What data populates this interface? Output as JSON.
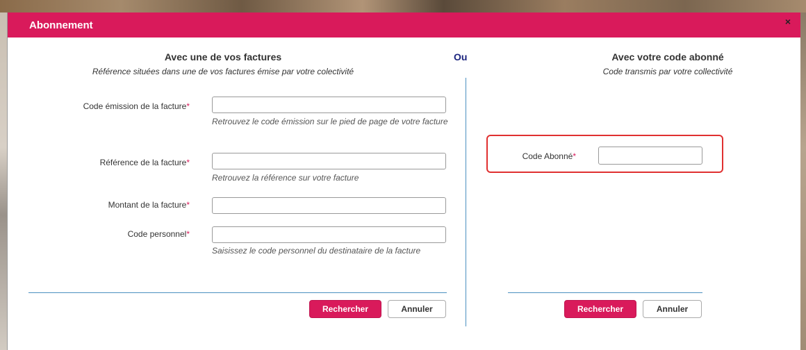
{
  "modal": {
    "title": "Abonnement",
    "close_label": "×"
  },
  "left": {
    "title": "Avec une de vos factures",
    "subtitle": "Référence situées dans une de vos factures émise par votre colectivité",
    "fields": [
      {
        "label": "Code émission de la facture",
        "required": "*",
        "value": "",
        "help": "Retrouvez le code émission sur le pied de page de votre facture"
      },
      {
        "label": "Référence de la facture",
        "required": "*",
        "value": "",
        "help": "Retrouvez la référence sur votre facture"
      },
      {
        "label": "Montant de la facture",
        "required": "*",
        "value": "",
        "help": ""
      },
      {
        "label": "Code personnel",
        "required": "*",
        "value": "",
        "help": "Saisissez le code personnel du destinataire de la facture"
      }
    ],
    "search_label": "Rechercher",
    "cancel_label": "Annuler"
  },
  "or_label": "Ou",
  "right": {
    "title": "Avec votre code abonné",
    "subtitle": "Code transmis par votre collectivité",
    "field": {
      "label": "Code Abonné",
      "required": "*",
      "value": ""
    },
    "search_label": "Rechercher",
    "cancel_label": "Annuler"
  },
  "colors": {
    "accent": "#d91a5b",
    "divider": "#4a90c0",
    "highlight": "#e03030",
    "or_text": "#1a237e"
  }
}
